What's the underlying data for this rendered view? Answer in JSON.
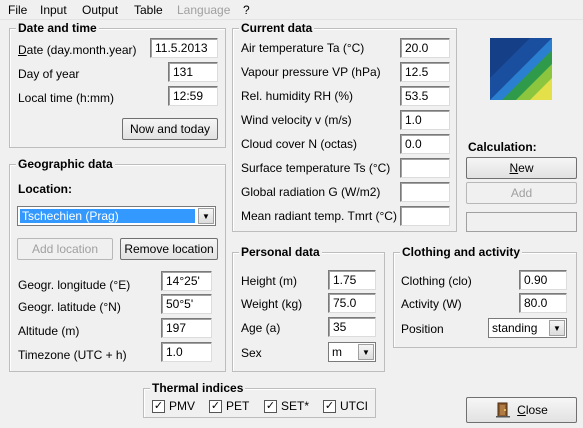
{
  "menu": {
    "file": "File",
    "input": "Input",
    "output": "Output",
    "table": "Table",
    "language": "Language",
    "help": "?"
  },
  "date_time": {
    "title": "Date and time",
    "date_label": "Date (day.month.year)",
    "date_value": "11.5.2013",
    "day_label": "Day of year",
    "day_value": "131",
    "time_label": "Local time (h:mm)",
    "time_value": "12:59",
    "now_button": "Now and today"
  },
  "geo": {
    "title": "Geographic data",
    "location_label": "Location:",
    "location_value": "Tschechien (Prag)",
    "add_location": "Add location",
    "remove_location": "Remove location",
    "longitude_label": "Geogr. longitude (°E)",
    "longitude_value": "14°25'",
    "latitude_label": "Geogr. latitude (°N)",
    "latitude_value": "50°5'",
    "altitude_label": "Altitude (m)",
    "altitude_value": "197",
    "timezone_label": "Timezone (UTC + h)",
    "timezone_value": "1.0"
  },
  "current": {
    "title": "Current data",
    "air_temp_label": "Air temperature Ta (°C)",
    "air_temp_value": "20.0",
    "vapour_label": "Vapour pressure VP (hPa)",
    "vapour_value": "12.5",
    "humidity_label": "Rel. humidity RH (%)",
    "humidity_value": "53.5",
    "wind_label": "Wind velocity v (m/s)",
    "wind_value": "1.0",
    "cloud_label": "Cloud cover N (octas)",
    "cloud_value": "0.0",
    "surface_label": "Surface temperature Ts (°C)",
    "surface_value": "",
    "radiation_label": "Global radiation G (W/m2)",
    "radiation_value": "",
    "mrt_label": "Mean radiant temp. Tmrt (°C)",
    "mrt_value": ""
  },
  "calc": {
    "title": "Calculation:",
    "new_button": "New",
    "add_button": "Add",
    "status_value": ""
  },
  "personal": {
    "title": "Personal data",
    "height_label": "Height (m)",
    "height_value": "1.75",
    "weight_label": "Weight (kg)",
    "weight_value": "75.0",
    "age_label": "Age (a)",
    "age_value": "35",
    "sex_label": "Sex",
    "sex_value": "m"
  },
  "clothing": {
    "title": "Clothing and activity",
    "clo_label": "Clothing (clo)",
    "clo_value": "0.90",
    "activity_label": "Activity (W)",
    "activity_value": "80.0",
    "position_label": "Position",
    "position_value": "standing"
  },
  "indices": {
    "title": "Thermal indices",
    "items": [
      {
        "label": "PMV",
        "checked": true
      },
      {
        "label": "PET",
        "checked": true
      },
      {
        "label": "SET*",
        "checked": true
      },
      {
        "label": "UTCI",
        "checked": true
      }
    ]
  },
  "close_button": "Close",
  "colors": {
    "logo_dark_blue": "#1a4fa0",
    "logo_blue": "#2a7fd0",
    "logo_green": "#2e9a4a",
    "logo_light_green": "#8cc63f",
    "logo_yellow": "#e3e04a",
    "selection": "#3399ff"
  }
}
